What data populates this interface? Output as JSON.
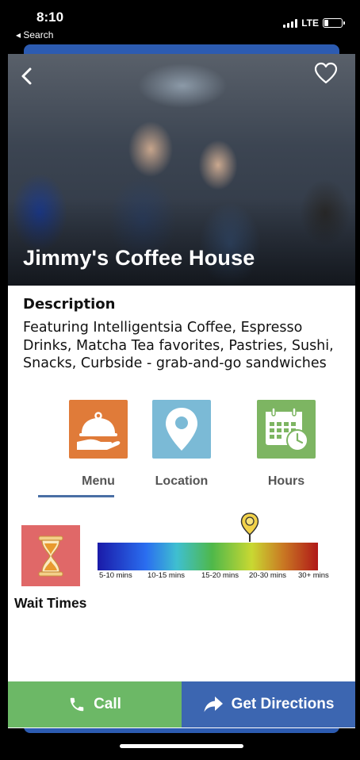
{
  "status_bar": {
    "time": "8:10",
    "back_label": "◂ Search",
    "network": "LTE"
  },
  "hero": {
    "title": "Jimmy's Coffee House"
  },
  "description": {
    "heading": "Description",
    "text": "Featuring Intelligentsia Coffee, Espresso Drinks, Matcha Tea favorites, Pastries, Sushi, Snacks, Curbside - grab-and-go sandwiches"
  },
  "tabs": [
    {
      "label": "Menu",
      "icon": "cloche-icon",
      "color": "#e07b39",
      "selected": true
    },
    {
      "label": "Location",
      "icon": "location-pin-icon",
      "color": "#7bbad6",
      "selected": false
    },
    {
      "label": "Hours",
      "icon": "calendar-clock-icon",
      "color": "#7db562",
      "selected": false
    }
  ],
  "wait_times": {
    "label": "Wait Times",
    "scale": [
      "5-10 mins",
      "10-15 mins",
      "15-20 mins",
      "20-30 mins",
      "30+ mins"
    ],
    "current_level_fraction": 0.69,
    "icon": "hourglass-icon",
    "icon_bg": "#e06868"
  },
  "actions": {
    "call_label": "Call",
    "directions_label": "Get Directions",
    "call_color": "#6cb866",
    "directions_color": "#3c66b1"
  },
  "colors": {
    "accent": "#2c5bb1",
    "tab_underline": "#4a6fa5"
  }
}
